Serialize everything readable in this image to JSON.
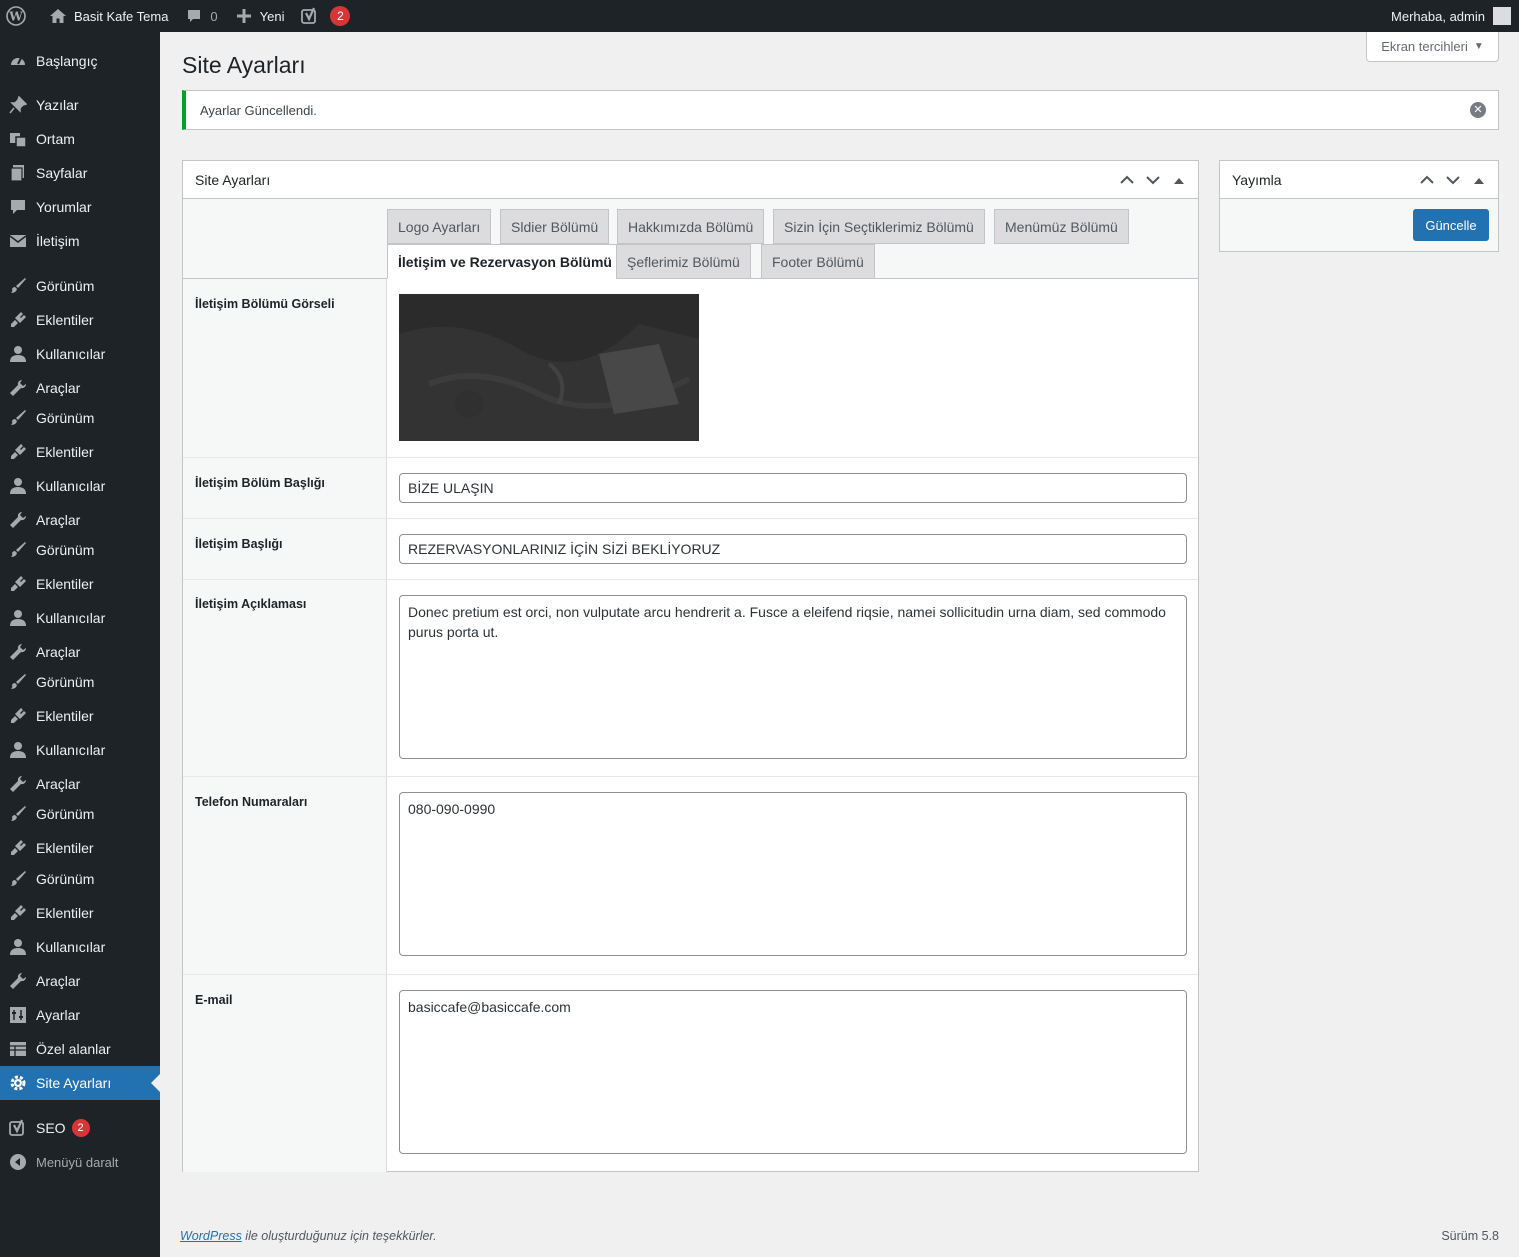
{
  "adminbar": {
    "site_name": "Basit Kafe Tema",
    "comments_count": "0",
    "new_label": "Yeni",
    "seo_badge": "2",
    "greeting": "Merhaba, admin"
  },
  "sidebar": {
    "items": [
      {
        "label": "Başlangıç",
        "icon": "dashboard-icon"
      },
      {
        "label": "Yazılar",
        "icon": "pin-icon"
      },
      {
        "label": "Ortam",
        "icon": "media-icon"
      },
      {
        "label": "Sayfalar",
        "icon": "page-icon"
      },
      {
        "label": "Yorumlar",
        "icon": "comment-icon"
      },
      {
        "label": "İletişim",
        "icon": "mail-icon"
      },
      {
        "label": "Görünüm",
        "icon": "brush-icon"
      },
      {
        "label": "Eklentiler",
        "icon": "plugin-icon"
      },
      {
        "label": "Kullanıcılar",
        "icon": "user-icon"
      },
      {
        "label": "Araçlar",
        "icon": "wrench-icon"
      },
      {
        "label": "Görünüm",
        "icon": "brush-icon"
      },
      {
        "label": "Eklentiler",
        "icon": "plugin-icon"
      },
      {
        "label": "Kullanıcılar",
        "icon": "user-icon"
      },
      {
        "label": "Araçlar",
        "icon": "wrench-icon"
      },
      {
        "label": "Görünüm",
        "icon": "brush-icon"
      },
      {
        "label": "Eklentiler",
        "icon": "plugin-icon"
      },
      {
        "label": "Kullanıcılar",
        "icon": "user-icon"
      },
      {
        "label": "Araçlar",
        "icon": "wrench-icon"
      },
      {
        "label": "Görünüm",
        "icon": "brush-icon"
      },
      {
        "label": "Eklentiler",
        "icon": "plugin-icon"
      },
      {
        "label": "Kullanıcılar",
        "icon": "user-icon"
      },
      {
        "label": "Araçlar",
        "icon": "wrench-icon"
      },
      {
        "label": "Görünüm",
        "icon": "brush-icon"
      },
      {
        "label": "Eklentiler",
        "icon": "plugin-icon"
      },
      {
        "label": "Görünüm",
        "icon": "brush-icon"
      },
      {
        "label": "Eklentiler",
        "icon": "plugin-icon"
      },
      {
        "label": "Kullanıcılar",
        "icon": "user-icon"
      },
      {
        "label": "Araçlar",
        "icon": "wrench-icon"
      },
      {
        "label": "Ayarlar",
        "icon": "settings-icon"
      },
      {
        "label": "Özel alanlar",
        "icon": "table-icon"
      },
      {
        "label": "Site Ayarları",
        "icon": "gear-icon"
      },
      {
        "label": "SEO",
        "icon": "yoast-icon"
      },
      {
        "label": "Menüyü daralt",
        "icon": "collapse-icon"
      }
    ],
    "seo_badge": "2"
  },
  "screen_options_label": "Ekran tercihleri",
  "page_title": "Site Ayarları",
  "notice_text": "Ayarlar Güncellendi.",
  "main_box": {
    "title": "Site Ayarları",
    "tabs_row1": [
      "Logo Ayarları",
      "Sldier Bölümü",
      "Hakkımızda Bölümü",
      "Sizin İçin Seçtiklerimiz Bölümü",
      "Menümüz Bölümü"
    ],
    "tabs_row2": [
      "İletişim ve Rezervasyon Bölümü",
      "Şeflerimiz Bölümü",
      "Footer Bölümü"
    ],
    "active_tab": "İletişim ve Rezervasyon Bölümü",
    "fields": {
      "image_label": "İletişim Bölümü Görseli",
      "section_title_label": "İletişim Bölüm Başlığı",
      "section_title_value": "BİZE ULAŞIN",
      "contact_title_label": "İletişim Başlığı",
      "contact_title_value": "REZERVASYONLARINIZ İÇİN SİZİ BEKLİYORUZ",
      "description_label": "İletişim Açıklaması",
      "description_value": "Donec pretium est orci, non vulputate arcu hendrerit a. Fusce a eleifend riqsie, namei sollicitudin urna diam, sed commodo purus porta ut.",
      "phone_label": "Telefon Numaraları",
      "phone_value": "080-090-0990",
      "email_label": "E-mail",
      "email_value": "basiccafe@basiccafe.com"
    }
  },
  "publish_box": {
    "title": "Yayımla",
    "update_button": "Güncelle"
  },
  "footer": {
    "link_text": "WordPress",
    "text": " ile oluşturduğunuz için teşekkürler.",
    "version": "Sürüm 5.8"
  },
  "colors": {
    "accent": "#2271b1",
    "success": "#00a32a",
    "badge": "#d63638",
    "sidebar": "#1d2327"
  }
}
